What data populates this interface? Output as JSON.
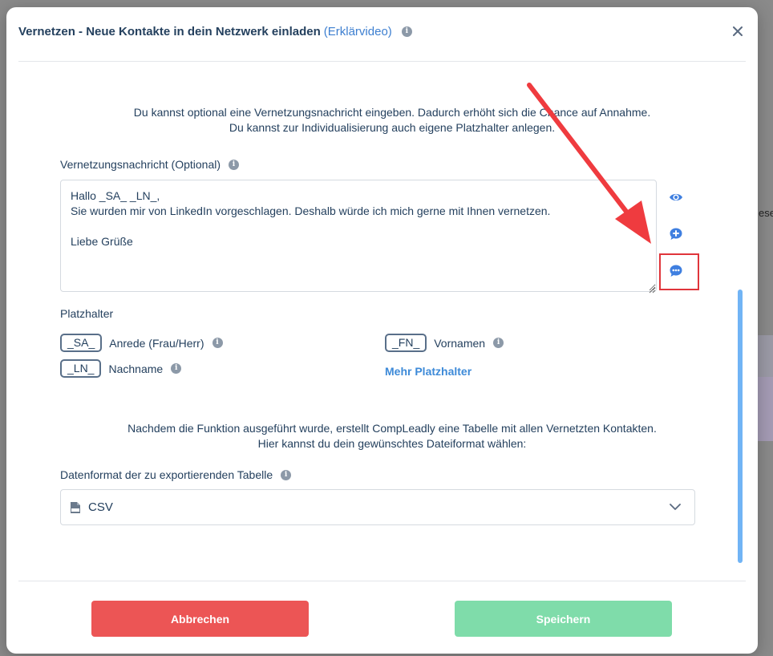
{
  "modal": {
    "title": "Vernetzen - Neue Kontakte in dein Netzwerk einladen",
    "title_link": "(Erklärvideo)",
    "intro_line1": "Du kannst optional eine Vernetzungsnachricht eingeben. Dadurch erhöht sich die Chance auf Annahme.",
    "intro_line2": "Du kannst zur Individualisierung auch eigene Platzhalter anlegen.",
    "message_label": "Vernetzungsnachricht (Optional)",
    "message_value": "Hallo _SA_ _LN_,\nSie wurden mir von LinkedIn vorgeschlagen. Deshalb würde ich mich gerne mit Ihnen vernetzen.\n\nLiebe Grüße",
    "placeholders_label": "Platzhalter",
    "placeholders": [
      {
        "tag": "_SA_",
        "desc": "Anrede (Frau/Herr)"
      },
      {
        "tag": "_LN_",
        "desc": "Nachname"
      },
      {
        "tag": "_FN_",
        "desc": "Vornamen"
      }
    ],
    "more_placeholders": "Mehr Platzhalter",
    "export_line1": "Nachdem die Funktion ausgeführt wurde, erstellt CompLeadly eine Tabelle mit allen Vernetzten Kontakten.",
    "export_line2": "Hier kannst du dein gewünschtes Dateiformat wählen:",
    "format_label": "Datenformat der zu exportierenden Tabelle",
    "format_value": "CSV",
    "cancel_label": "Abbrechen",
    "save_label": "Speichern"
  },
  "background": {
    "text": "ese"
  },
  "colors": {
    "title": "#24405e",
    "link": "#3d7fd0",
    "cancel": "#ec5555",
    "save": "#7fdcaa",
    "icon_blue": "#3f7fe0",
    "highlight": "#e0353b",
    "scrollbar": "#71b4f5"
  },
  "icons": {
    "info": "info-icon",
    "close": "close-icon",
    "preview": "eye-icon",
    "add": "plus-bubble-icon",
    "message": "chat-bubble-icon",
    "file": "csv-file-icon",
    "dropdown": "chevron-down-icon"
  }
}
